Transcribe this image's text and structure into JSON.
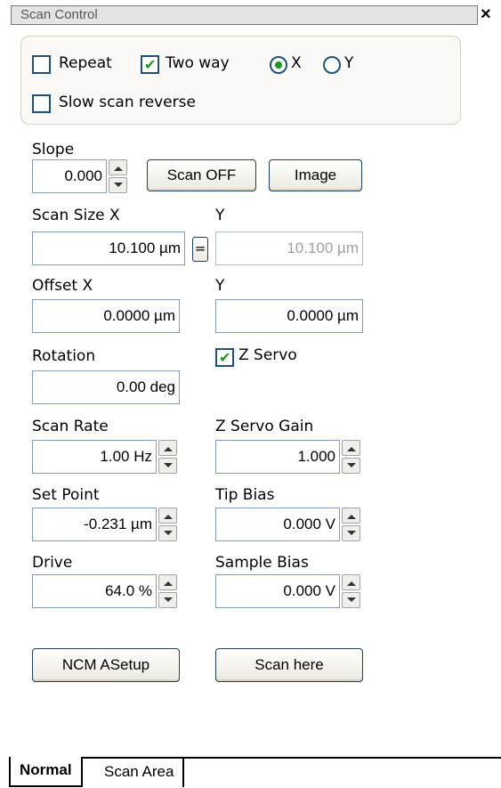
{
  "window": {
    "title": "Scan Control",
    "close_glyph": "×"
  },
  "options": {
    "repeat": {
      "label": "Repeat",
      "checked": false
    },
    "two_way": {
      "label": "Two way",
      "checked": true
    },
    "axis_x": {
      "label": "X",
      "selected": true
    },
    "axis_y": {
      "label": "Y",
      "selected": false
    },
    "slow_scan_reverse": {
      "label": "Slow scan reverse",
      "checked": false
    }
  },
  "slope": {
    "label": "Slope",
    "value": "0.000"
  },
  "buttons": {
    "scan_off": "Scan OFF",
    "image": "Image",
    "ncm_asetup": "NCM ASetup",
    "scan_here": "Scan here",
    "equal": "="
  },
  "scan_size": {
    "label_x": "Scan Size X",
    "label_y": "Y",
    "x": "10.100 µm",
    "y": "10.100 µm"
  },
  "offset": {
    "label_x": "Offset X",
    "label_y": "Y",
    "x": "0.0000 µm",
    "y": "0.0000 µm"
  },
  "rotation": {
    "label": "Rotation",
    "value": "0.00 deg"
  },
  "z_servo": {
    "label": "Z Servo",
    "checked": true
  },
  "scan_rate": {
    "label": "Scan Rate",
    "value": "1.00 Hz"
  },
  "z_servo_gain": {
    "label": "Z Servo Gain",
    "value": "1.000"
  },
  "set_point": {
    "label": "Set Point",
    "value": "-0.231 µm"
  },
  "tip_bias": {
    "label": "Tip Bias",
    "value": "0.000 V"
  },
  "drive": {
    "label": "Drive",
    "value": "64.0 %"
  },
  "sample_bias": {
    "label": "Sample Bias",
    "value": "0.000 V"
  },
  "tabs": [
    {
      "label": "Normal",
      "active": true
    },
    {
      "label": "Scan Area",
      "active": false
    }
  ]
}
